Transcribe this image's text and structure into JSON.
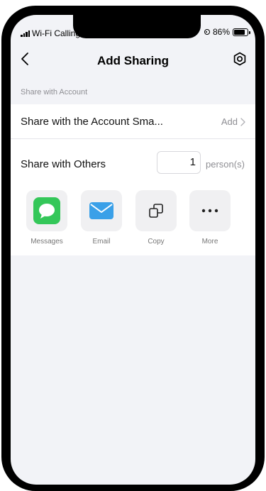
{
  "status_bar": {
    "carrier": "Wi-Fi Calling",
    "battery_percent": "86%",
    "battery_level": 0.86
  },
  "header": {
    "title": "Add Sharing",
    "back_icon": "chevron-left-icon",
    "settings_icon": "settings-icon"
  },
  "share_account": {
    "section_label": "Share with Account",
    "row_label": "Share with the Account Sma...",
    "action_label": "Add"
  },
  "share_others": {
    "label": "Share with Others",
    "count_value": "1",
    "unit_label": "person(s)",
    "options": [
      {
        "label": "Messages",
        "icon": "messages-icon",
        "color": "#34c759"
      },
      {
        "label": "Email",
        "icon": "email-icon",
        "color": "#3aa0e8"
      },
      {
        "label": "Copy",
        "icon": "copy-icon"
      },
      {
        "label": "More",
        "icon": "more-icon"
      }
    ]
  },
  "colors": {
    "background": "#f2f3f7",
    "secondary_text": "#8e8e93"
  }
}
